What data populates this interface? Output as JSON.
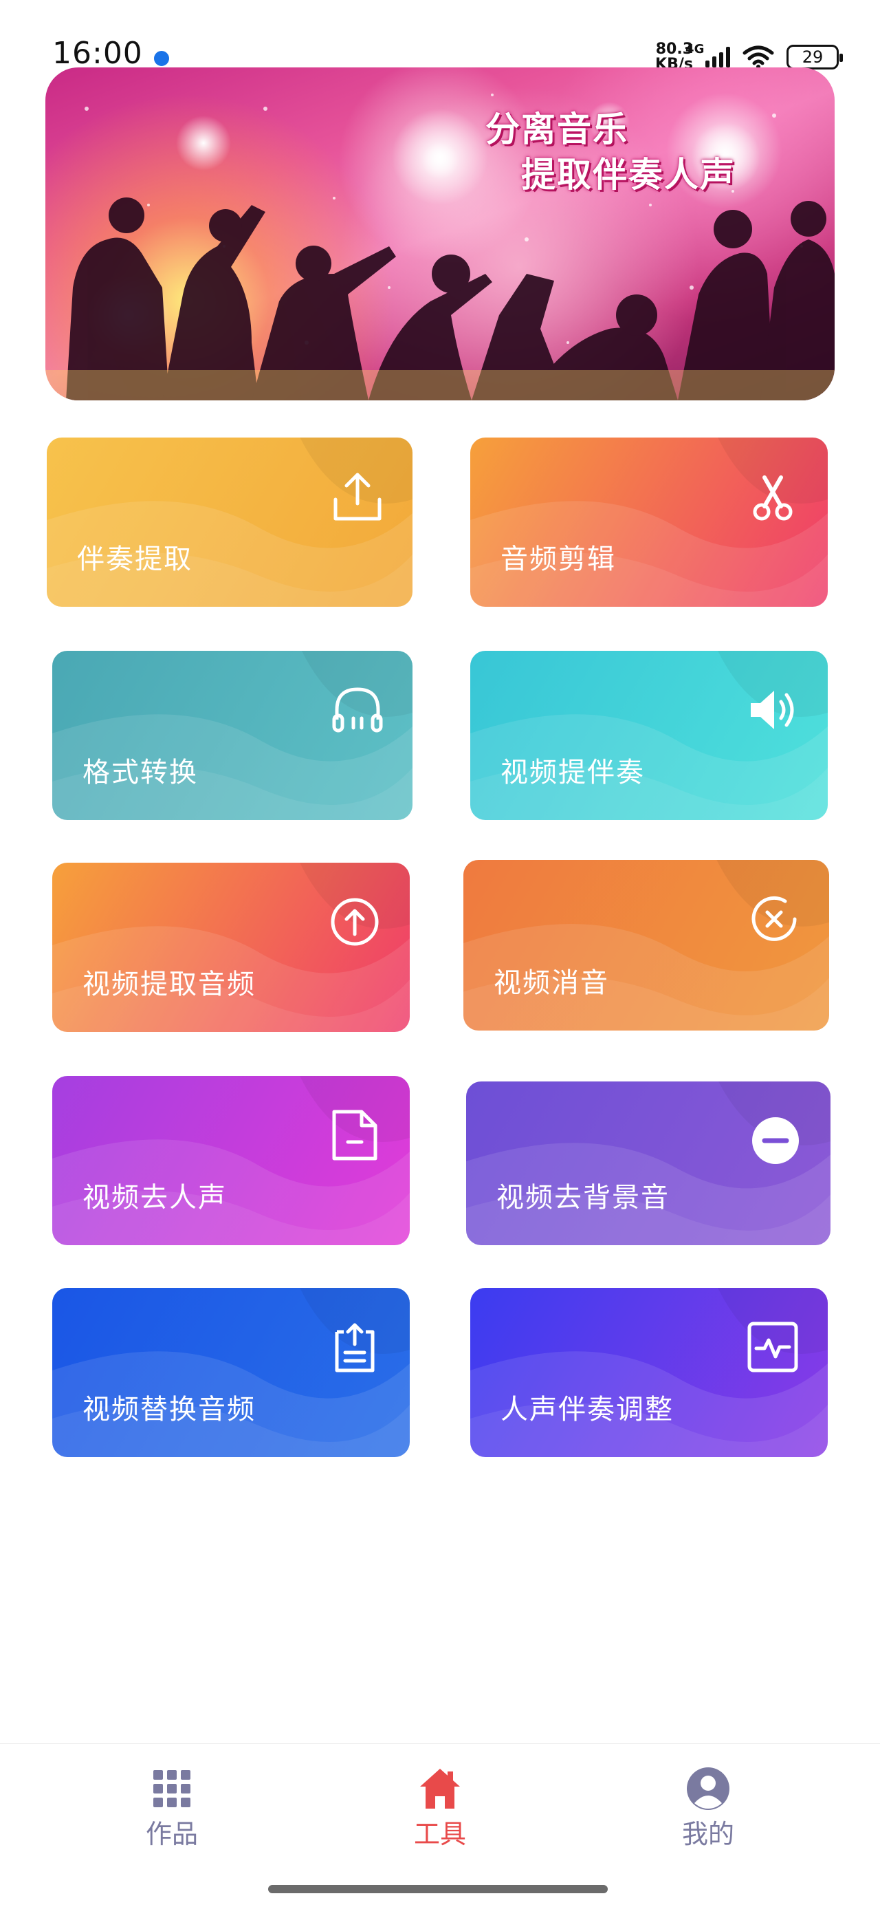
{
  "status_bar": {
    "time": "16:00",
    "net_speed_value": "80.3",
    "net_speed_unit": "KB/s",
    "network_type": "4G",
    "battery": "29",
    "icons": [
      "app-notification-icon",
      "signal-icon",
      "wifi-icon",
      "battery-icon"
    ]
  },
  "banner": {
    "line1": "分离音乐",
    "line2": "提取伴奏人声"
  },
  "tools": [
    {
      "label": "伴奏提取",
      "icon": "upload-icon",
      "colors": [
        "#f7c24c",
        "#f2a93a"
      ]
    },
    {
      "label": "音频剪辑",
      "icon": "scissors-icon",
      "colors": [
        "#f6a03b",
        "#ef3b6a"
      ]
    },
    {
      "label": "格式转换",
      "icon": "headphones-icon",
      "colors": [
        "#4aa8b4",
        "#5ec0c6"
      ]
    },
    {
      "label": "视频提伴奏",
      "icon": "speaker-icon",
      "colors": [
        "#38c6d6",
        "#4fe0dc"
      ]
    },
    {
      "label": "视频提取音频",
      "icon": "upload-circle-icon",
      "colors": [
        "#f6a03b",
        "#ef3b6a"
      ]
    },
    {
      "label": "视频消音",
      "icon": "close-circle-icon",
      "colors": [
        "#ef7a3f",
        "#f0983e"
      ]
    },
    {
      "label": "视频去人声",
      "icon": "document-icon",
      "colors": [
        "#a53fe0",
        "#e23bd8"
      ]
    },
    {
      "label": "视频去背景音",
      "icon": "minus-circle-icon",
      "colors": [
        "#6d4fd6",
        "#8c5ad6"
      ]
    },
    {
      "label": "视频替换音频",
      "icon": "clipboard-upload-icon",
      "colors": [
        "#1a56e6",
        "#2a6ee8"
      ]
    },
    {
      "label": "人声伴奏调整",
      "icon": "waveform-icon",
      "colors": [
        "#3b3cf0",
        "#8a3be6"
      ]
    }
  ],
  "bottom_nav": {
    "items": [
      {
        "label": "作品",
        "icon": "grid-icon",
        "active": false
      },
      {
        "label": "工具",
        "icon": "home-icon",
        "active": true
      },
      {
        "label": "我的",
        "icon": "user-icon",
        "active": false
      }
    ],
    "active_color": "#e84a4a",
    "inactive_color": "#7a7aa0"
  }
}
